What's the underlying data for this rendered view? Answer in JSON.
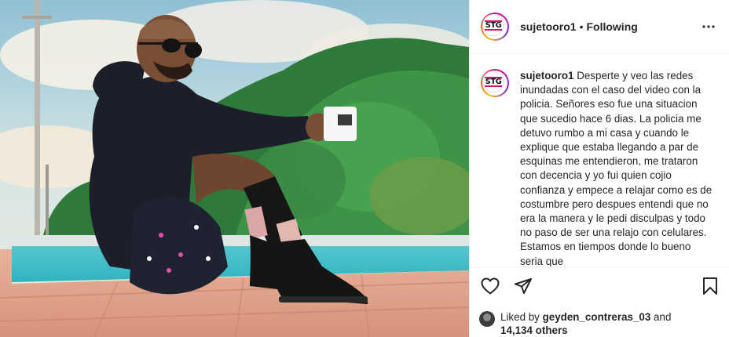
{
  "post": {
    "username": "sujetooro1",
    "dot": "•",
    "follow_status": "Following",
    "avatar_logo_text": "STG",
    "caption": "Desperte y veo las redes inundadas con el caso del video con la policia. Señores eso fue una situacion que sucedio hace 6 dias. La policia me detuvo rumbo a mi casa y cuando le explique que estaba llegando a par de esquinas me entendieron, me trataron con decencia y yo fui quien cojio confianza y empece a relajar como es de costumbre pero despues entendi que no era la manera y le pedi disculpas y todo no paso de ser una relajo con celulares. Estamos en tiempos donde lo bueno seria que"
  },
  "likes": {
    "prefix": "Liked by",
    "user": "geyden_contreras_03",
    "and": "and",
    "count": "14,134 others"
  },
  "icons": {
    "more": "more-horizontal-icon",
    "like": "heart-icon",
    "share": "paper-plane-icon",
    "save": "bookmark-icon"
  },
  "colors": {
    "ring_gradient": [
      "#f9c200",
      "#f35b2f",
      "#d3136d",
      "#b31bb1",
      "#7f2fd1"
    ],
    "border": "#efefef",
    "text": "#262626"
  }
}
